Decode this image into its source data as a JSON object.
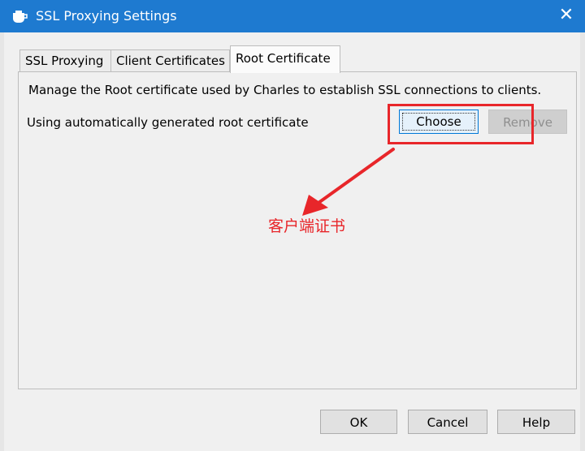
{
  "window": {
    "title": "SSL Proxying Settings",
    "close_glyph": "✕",
    "app_icon": "charles-teapot-icon"
  },
  "tabs": [
    {
      "label": "SSL Proxying",
      "active": false
    },
    {
      "label": "Client Certificates",
      "active": false
    },
    {
      "label": "Root Certificate",
      "active": true
    }
  ],
  "root_certificate": {
    "description": "Manage the Root certificate used by Charles to establish SSL connections to clients.",
    "status": "Using automatically generated root certificate",
    "choose_label": "Choose",
    "remove_label": "Remove"
  },
  "annotation": {
    "text": "客户端证书",
    "color": "#e8262a"
  },
  "footer": {
    "ok_label": "OK",
    "cancel_label": "Cancel",
    "help_label": "Help"
  },
  "colors": {
    "titlebar": "#1e7ad0",
    "focus_border": "#0078d7"
  }
}
